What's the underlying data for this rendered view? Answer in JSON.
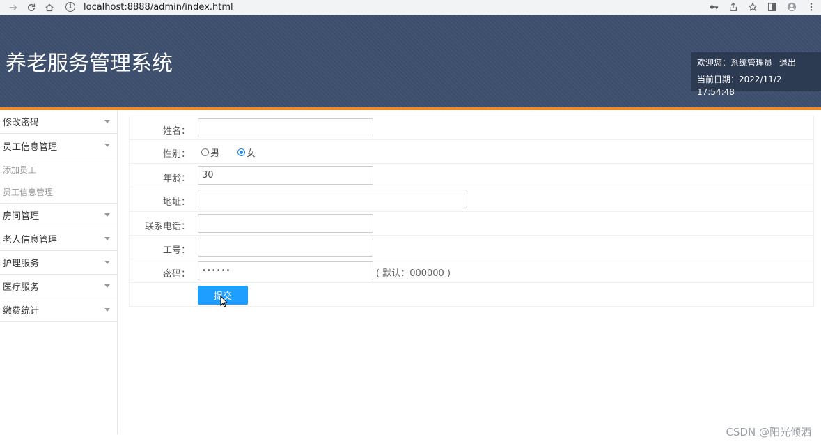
{
  "browser": {
    "url": "localhost:8888/admin/index.html"
  },
  "header": {
    "title": "养老服务管理系统",
    "welcome": "欢迎您：系统管理员",
    "logout": "退出",
    "date_label": "当前日期：2022/11/2 17:54:48"
  },
  "sidebar": {
    "items": [
      {
        "label": "修改密码"
      },
      {
        "label": "员工信息管理"
      },
      {
        "label": "添加员工"
      },
      {
        "label": "员工信息管理"
      },
      {
        "label": "房间管理"
      },
      {
        "label": "老人信息管理"
      },
      {
        "label": "护理服务"
      },
      {
        "label": "医疗服务"
      },
      {
        "label": "缴费统计"
      }
    ]
  },
  "form": {
    "name_label": "姓名：",
    "name_value": "",
    "gender_label": "性别：",
    "gender_male": "男",
    "gender_female": "女",
    "gender_selected": "女",
    "age_label": "年龄：",
    "age_value": "30",
    "address_label": "地址：",
    "address_value": "",
    "phone_label": "联系电话：",
    "phone_value": "",
    "jobno_label": "工号：",
    "jobno_value": "",
    "password_label": "密码：",
    "password_value": "••••••",
    "password_hint": "( 默认：000000 )",
    "submit_label": "提交"
  },
  "watermark": "CSDN @阳光倾洒",
  "colors": {
    "header_bg": "#3d4f6e",
    "accent_bar": "#f08c26",
    "submit_bg": "#1e9fff"
  }
}
